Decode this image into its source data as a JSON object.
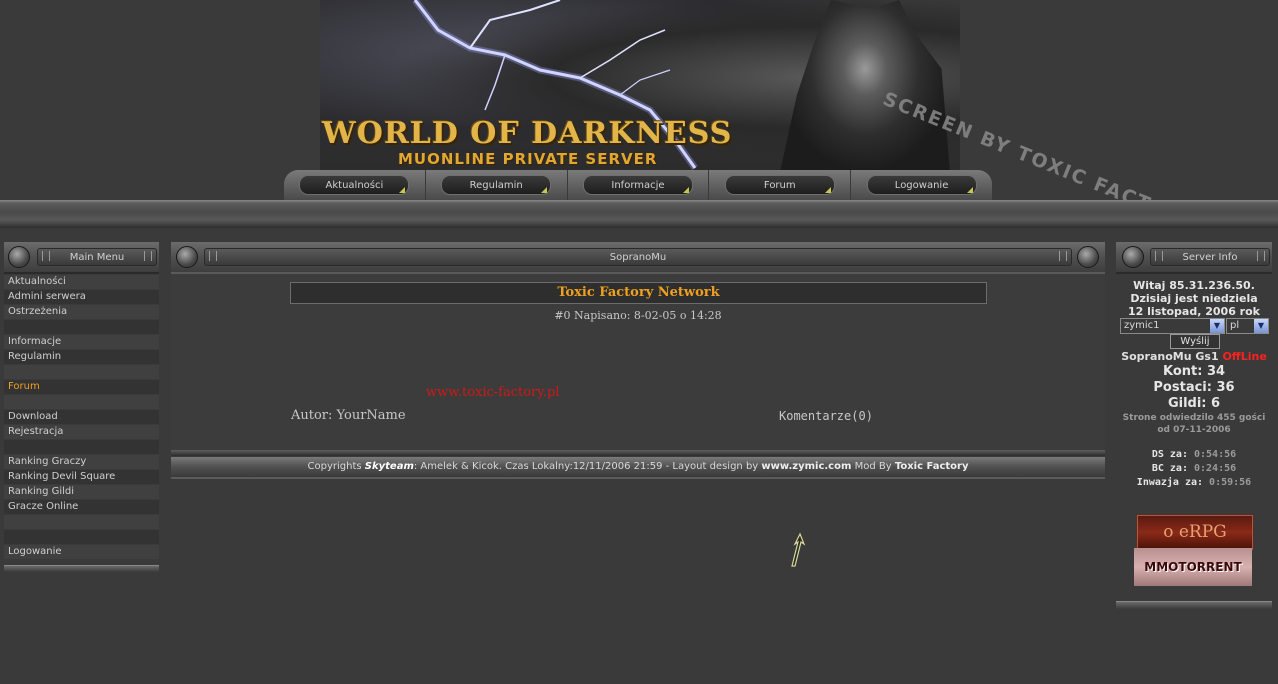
{
  "header": {
    "logo_title": "WORLD OF DARKNESS",
    "logo_subtitle": "MUONLINE PRIVATE SERVER",
    "watermark": "SCREEN BY TOXIC FACTORY"
  },
  "nav": {
    "items": [
      "Aktualności",
      "Regulamin",
      "Informacje",
      "Forum",
      "Logowanie"
    ]
  },
  "left_panel": {
    "title": "Main Menu",
    "items": [
      {
        "label": "Aktualności"
      },
      {
        "label": "Admini serwera"
      },
      {
        "label": "Ostrzeżenia"
      },
      {
        "label": ""
      },
      {
        "label": "Informacje"
      },
      {
        "label": "Regulamin"
      },
      {
        "label": ""
      },
      {
        "label": "Forum"
      },
      {
        "label": ""
      },
      {
        "label": "Download"
      },
      {
        "label": "Rejestracja"
      },
      {
        "label": ""
      },
      {
        "label": "Ranking Graczy"
      },
      {
        "label": "Ranking Devil Square"
      },
      {
        "label": "Ranking Gildi"
      },
      {
        "label": "Gracze Online"
      },
      {
        "label": ""
      },
      {
        "label": ""
      },
      {
        "label": "Logowanie"
      }
    ],
    "active_item": "Forum",
    "active_color": "#f0a020"
  },
  "center": {
    "title": "SopranoMu",
    "news": {
      "title": "Toxic Factory Network",
      "meta": "#0 Napisano: 8-02-05 o 14:28",
      "link": "www.toxic-factory.pl",
      "author": "Autor: YourName",
      "comments": "Komentarze(0)"
    },
    "footer": {
      "prefix": "Copyrights ",
      "team": "Skyteam",
      "mid": ": Amelek & Kicok. Czas Lokalny:12/11/2006 21:59 - Layout design by ",
      "site": "www.zymic.com",
      "mod": " Mod By ",
      "modder": "Toxic Factory"
    }
  },
  "right_panel": {
    "title": "Server Info",
    "greeting_line1": "Witaj 85.31.236.50.",
    "greeting_line2": "Dzisiaj jest niedziela",
    "greeting_line3": "12 listopad, 2006 rok",
    "theme_select": "zymic1",
    "lang_select": "pl",
    "send_button": "Wyślij",
    "server_name": "SopranoMu Gs1 ",
    "server_status": "OffLine",
    "accounts": "Kont: 34",
    "characters": "Postaci: 36",
    "guilds": "Gildi: 6",
    "visits_line1": "Strone odwiedzilo 455 gości",
    "visits_line2": "od 07-11-2006",
    "ds_label": "DS za: ",
    "ds_time": "0:54:56",
    "bc_label": "BC za: ",
    "bc_time": "0:24:56",
    "inv_label": "Inwazja za: ",
    "inv_time": "0:59:56",
    "banner1": "o eRPG",
    "banner2": "MMOTORRENT"
  },
  "colors": {
    "accent_orange": "#f0a020",
    "offline_red": "#ff2020",
    "link_red": "#d01818"
  }
}
